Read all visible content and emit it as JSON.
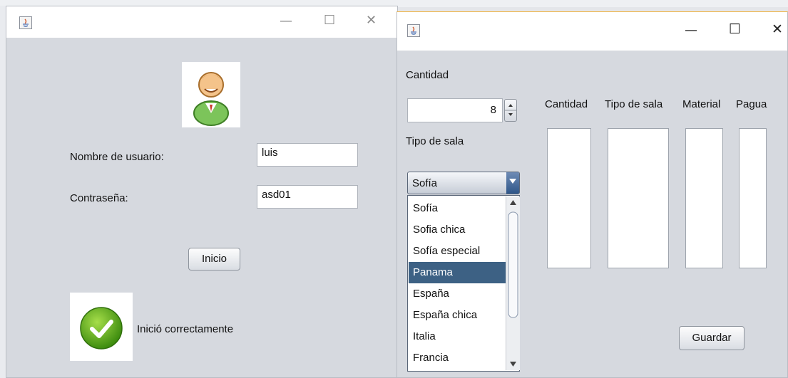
{
  "login_window": {
    "title_controls": {
      "minimize": "—",
      "maximize": "☐",
      "close": "✕"
    },
    "username_label": "Nombre de usuario:",
    "username_value": "luis",
    "password_label": "Contraseña:",
    "password_value": "asd01",
    "login_button": "Inicio",
    "status_text": "Inició correctamente"
  },
  "order_window": {
    "title_controls": {
      "minimize": "—",
      "maximize": "☐",
      "close": "✕"
    },
    "quantity_label": "Cantidad",
    "quantity_value": "8",
    "room_type_label": "Tipo de sala",
    "room_type_selected": "Sofía",
    "room_type_options": [
      "Sofía",
      "Sofia chica",
      "Sofía especial",
      "Panama",
      "España",
      "España chica",
      "Italia",
      "Francia"
    ],
    "highlighted_option": "Panama",
    "columns": [
      "Cantidad",
      "Tipo de sala",
      "Material",
      "Pagua"
    ],
    "save_button": "Guardar"
  },
  "colors": {
    "window_bg": "#d6d9df",
    "selection": "#3d6184",
    "accept_green": "#5ea316"
  },
  "icons": [
    "java-app-icon",
    "user-avatar-icon",
    "checkmark-icon",
    "scroll-up-icon",
    "scroll-down-icon",
    "combo-arrow-icon"
  ]
}
